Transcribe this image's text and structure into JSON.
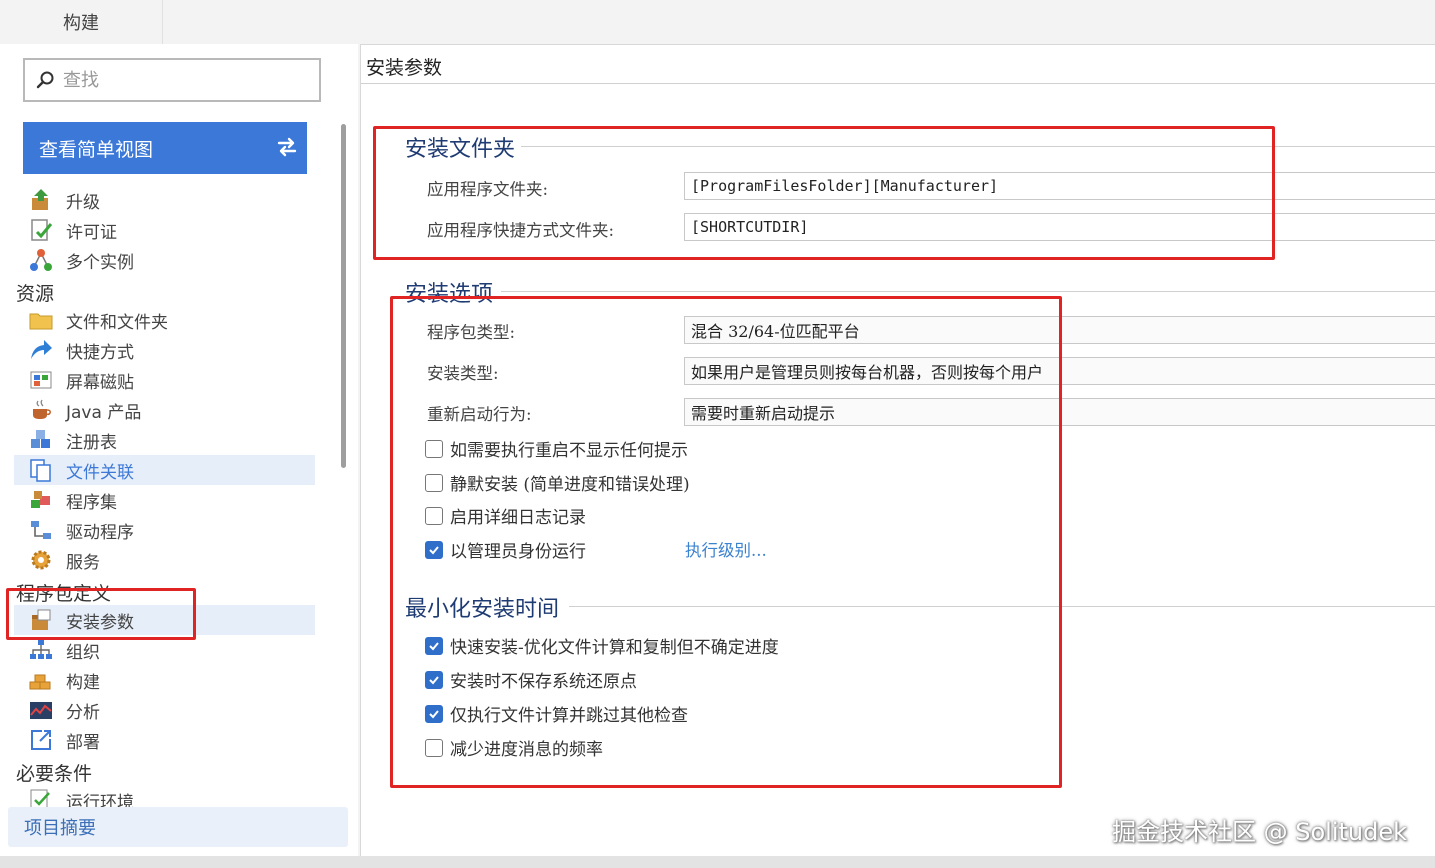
{
  "top_tab": {
    "label": "构建"
  },
  "sidebar": {
    "search_placeholder": "查找",
    "view_button_label": "查看简单视图",
    "items_top": [
      {
        "label": "升级",
        "icon": "upgrade-box-icon"
      },
      {
        "label": "许可证",
        "icon": "license-check-icon"
      },
      {
        "label": "多个实例",
        "icon": "instances-icon"
      }
    ],
    "section_resources": "资源",
    "items_resources": [
      {
        "label": "文件和文件夹",
        "icon": "folder-icon"
      },
      {
        "label": "快捷方式",
        "icon": "shortcut-arrow-icon"
      },
      {
        "label": "屏幕磁贴",
        "icon": "tiles-icon"
      },
      {
        "label": "Java 产品",
        "icon": "java-cup-icon"
      },
      {
        "label": "注册表",
        "icon": "registry-cubes-icon"
      },
      {
        "label": "文件关联",
        "icon": "file-association-icon"
      },
      {
        "label": "程序集",
        "icon": "assembly-icon"
      },
      {
        "label": "驱动程序",
        "icon": "driver-icon"
      },
      {
        "label": "服务",
        "icon": "service-gear-icon"
      }
    ],
    "section_package": "程序包定义",
    "items_package": [
      {
        "label": "安装参数",
        "icon": "install-params-icon"
      },
      {
        "label": "组织",
        "icon": "organization-icon"
      },
      {
        "label": "构建",
        "icon": "build-bricks-icon"
      },
      {
        "label": "分析",
        "icon": "analysis-chart-icon"
      },
      {
        "label": "部署",
        "icon": "deploy-icon"
      }
    ],
    "section_prereq": "必要条件",
    "item_partial": "运行环境",
    "summary_label": "项目摘要"
  },
  "main": {
    "title": "安装参数",
    "group_folder": {
      "heading": "安装文件夹",
      "app_folder_label": "应用程序文件夹:",
      "app_folder_value": "[ProgramFilesFolder][Manufacturer]",
      "shortcut_folder_label": "应用程序快捷方式文件夹:",
      "shortcut_folder_value": "[SHORTCUTDIR]"
    },
    "group_options": {
      "heading": "安装选项",
      "package_type_label": "程序包类型:",
      "package_type_value": "混合 32/64-位匹配平台",
      "install_type_label": "安装类型:",
      "install_type_value": "如果用户是管理员则按每台机器，否则按每个用户",
      "reboot_label": "重新启动行为:",
      "reboot_value": "需要时重新启动提示",
      "checkboxes": [
        {
          "label": "如需要执行重启不显示任何提示",
          "checked": false
        },
        {
          "label": "静默安装 (简单进度和错误处理)",
          "checked": false
        },
        {
          "label": "启用详细日志记录",
          "checked": false
        },
        {
          "label": "以管理员身份运行",
          "checked": true
        }
      ],
      "exec_level_link": "执行级别..."
    },
    "group_minimize": {
      "heading": "最小化安装时间",
      "checkboxes": [
        {
          "label": "快速安装-优化文件计算和复制但不确定进度",
          "checked": true
        },
        {
          "label": "安装时不保存系统还原点",
          "checked": true
        },
        {
          "label": "仅执行文件计算并跳过其他检查",
          "checked": true
        },
        {
          "label": "减少进度消息的频率",
          "checked": false
        }
      ]
    }
  },
  "watermark": "掘金技术社区 @ Solitudek",
  "colors": {
    "accent": "#3b78d8",
    "highlight_red": "#e02424",
    "heading_navy": "#1f3b73"
  }
}
